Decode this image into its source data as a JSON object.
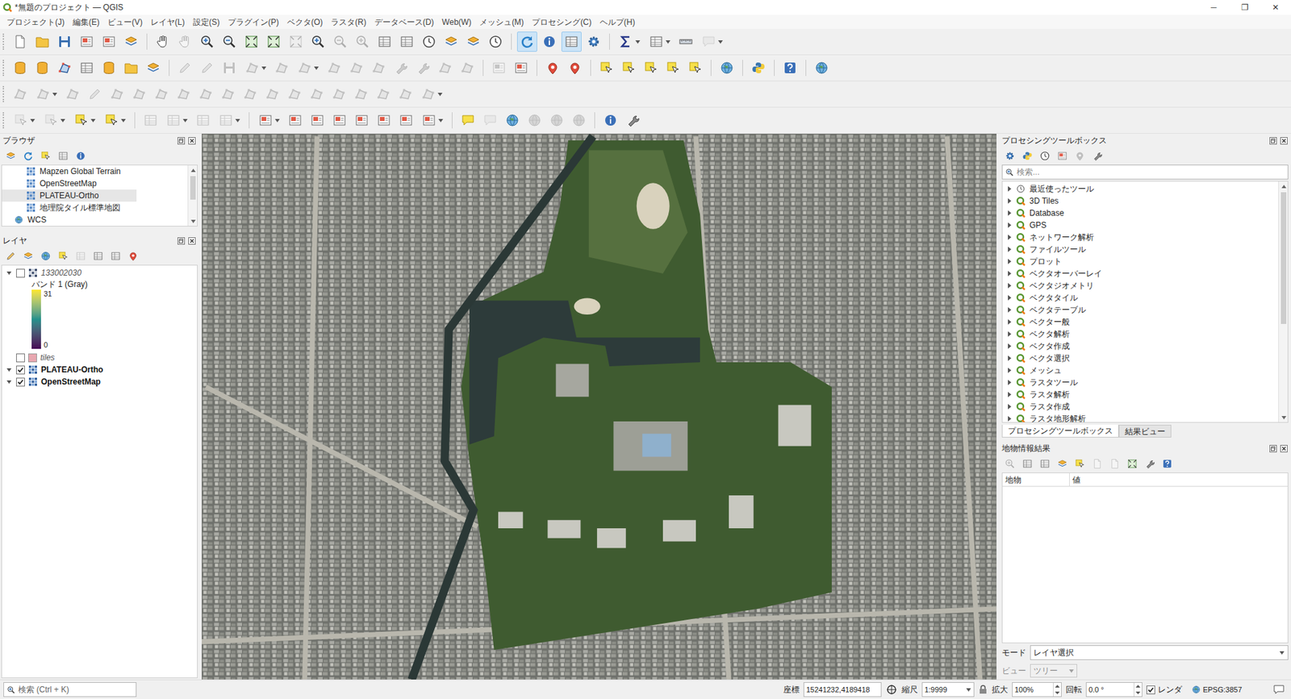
{
  "window": {
    "title": "*無題のプロジェクト — QGIS",
    "controls": [
      "─",
      "❐",
      "✕"
    ]
  },
  "menu": [
    "プロジェクト(J)",
    "編集(E)",
    "ビュー(V)",
    "レイヤ(L)",
    "設定(S)",
    "プラグイン(P)",
    "ベクタ(O)",
    "ラスタ(R)",
    "データベース(D)",
    "Web(W)",
    "メッシュ(M)",
    "プロセシング(C)",
    "ヘルプ(H)"
  ],
  "toolbars": [
    [
      {
        "kind": "icon",
        "disabled": false,
        "pressed": false
      },
      {
        "kind": "icon",
        "disabled": false,
        "pressed": false
      },
      {
        "kind": "icon",
        "disabled": false,
        "pressed": false
      },
      {
        "kind": "icon",
        "disabled": false,
        "pressed": false
      },
      {
        "kind": "icon",
        "disabled": false,
        "pressed": false
      },
      {
        "kind": "icon",
        "disabled": false,
        "pressed": false
      },
      {
        "kind": "sep"
      },
      {
        "kind": "icon",
        "disabled": false,
        "pressed": false
      },
      {
        "kind": "icon",
        "disabled": true,
        "pressed": false
      },
      {
        "kind": "icon",
        "disabled": false,
        "pressed": false
      },
      {
        "kind": "icon",
        "disabled": false,
        "pressed": false
      },
      {
        "kind": "icon",
        "disabled": false,
        "pressed": false
      },
      {
        "kind": "icon",
        "disabled": false,
        "pressed": false
      },
      {
        "kind": "icon",
        "disabled": true,
        "pressed": false
      },
      {
        "kind": "icon",
        "disabled": false,
        "pressed": false
      },
      {
        "kind": "icon",
        "disabled": true,
        "pressed": false
      },
      {
        "kind": "icon",
        "disabled": true,
        "pressed": false
      },
      {
        "kind": "icon",
        "disabled": false,
        "pressed": false
      },
      {
        "kind": "icon",
        "disabled": false,
        "pressed": false
      },
      {
        "kind": "icon",
        "disabled": false,
        "pressed": false
      },
      {
        "kind": "icon",
        "disabled": false,
        "pressed": false
      },
      {
        "kind": "icon",
        "disabled": false,
        "pressed": false
      },
      {
        "kind": "icon",
        "disabled": false,
        "pressed": false
      },
      {
        "kind": "sep"
      },
      {
        "kind": "icon",
        "disabled": false,
        "pressed": true
      },
      {
        "kind": "icon",
        "disabled": false,
        "pressed": false
      },
      {
        "kind": "icon",
        "disabled": false,
        "pressed": true
      },
      {
        "kind": "icon",
        "disabled": false,
        "pressed": false
      },
      {
        "kind": "sep"
      },
      {
        "kind": "drop",
        "disabled": false,
        "pressed": false
      },
      {
        "kind": "drop",
        "disabled": false,
        "pressed": false
      },
      {
        "kind": "icon",
        "disabled": false,
        "pressed": false
      },
      {
        "kind": "drop",
        "disabled": true,
        "pressed": false
      }
    ],
    [
      {
        "kind": "icon",
        "disabled": false,
        "pressed": false
      },
      {
        "kind": "icon",
        "disabled": false,
        "pressed": false
      },
      {
        "kind": "icon",
        "disabled": false,
        "pressed": false
      },
      {
        "kind": "icon",
        "disabled": false,
        "pressed": false
      },
      {
        "kind": "icon",
        "disabled": false,
        "pressed": false
      },
      {
        "kind": "icon",
        "disabled": false,
        "pressed": false
      },
      {
        "kind": "icon",
        "disabled": false,
        "pressed": false
      },
      {
        "kind": "sep"
      },
      {
        "kind": "icon",
        "disabled": true,
        "pressed": false
      },
      {
        "kind": "icon",
        "disabled": true,
        "pressed": false
      },
      {
        "kind": "icon",
        "disabled": true,
        "pressed": false
      },
      {
        "kind": "drop",
        "disabled": true,
        "pressed": false
      },
      {
        "kind": "icon",
        "disabled": true,
        "pressed": false
      },
      {
        "kind": "drop",
        "disabled": true,
        "pressed": false
      },
      {
        "kind": "icon",
        "disabled": true,
        "pressed": false
      },
      {
        "kind": "icon",
        "disabled": true,
        "pressed": false
      },
      {
        "kind": "icon",
        "disabled": true,
        "pressed": false
      },
      {
        "kind": "icon",
        "disabled": true,
        "pressed": false
      },
      {
        "kind": "icon",
        "disabled": true,
        "pressed": false
      },
      {
        "kind": "icon",
        "disabled": true,
        "pressed": false
      },
      {
        "kind": "icon",
        "disabled": true,
        "pressed": false
      },
      {
        "kind": "sep"
      },
      {
        "kind": "icon",
        "disabled": true,
        "pressed": false
      },
      {
        "kind": "icon",
        "disabled": false,
        "pressed": false
      },
      {
        "kind": "sep"
      },
      {
        "kind": "icon",
        "disabled": false,
        "pressed": false
      },
      {
        "kind": "icon",
        "disabled": false,
        "pressed": false
      },
      {
        "kind": "sep"
      },
      {
        "kind": "icon",
        "disabled": false,
        "pressed": false
      },
      {
        "kind": "icon",
        "disabled": false,
        "pressed": false
      },
      {
        "kind": "icon",
        "disabled": false,
        "pressed": false
      },
      {
        "kind": "icon",
        "disabled": false,
        "pressed": false
      },
      {
        "kind": "icon",
        "disabled": false,
        "pressed": false
      },
      {
        "kind": "sep"
      },
      {
        "kind": "icon",
        "disabled": false,
        "pressed": false
      },
      {
        "kind": "sep"
      },
      {
        "kind": "icon",
        "disabled": false,
        "pressed": false
      },
      {
        "kind": "sep"
      },
      {
        "kind": "icon",
        "disabled": false,
        "pressed": false
      },
      {
        "kind": "sep"
      },
      {
        "kind": "icon",
        "disabled": false,
        "pressed": false
      }
    ],
    [
      {
        "kind": "icon",
        "disabled": true,
        "pressed": false
      },
      {
        "kind": "drop",
        "disabled": true,
        "pressed": false
      },
      {
        "kind": "icon",
        "disabled": true,
        "pressed": false
      },
      {
        "kind": "icon",
        "disabled": true,
        "pressed": false
      },
      {
        "kind": "icon",
        "disabled": true,
        "pressed": false
      },
      {
        "kind": "icon",
        "disabled": true,
        "pressed": false
      },
      {
        "kind": "icon",
        "disabled": true,
        "pressed": false
      },
      {
        "kind": "icon",
        "disabled": true,
        "pressed": false
      },
      {
        "kind": "icon",
        "disabled": true,
        "pressed": false
      },
      {
        "kind": "icon",
        "disabled": true,
        "pressed": false
      },
      {
        "kind": "icon",
        "disabled": true,
        "pressed": false
      },
      {
        "kind": "icon",
        "disabled": true,
        "pressed": false
      },
      {
        "kind": "icon",
        "disabled": true,
        "pressed": false
      },
      {
        "kind": "icon",
        "disabled": true,
        "pressed": false
      },
      {
        "kind": "icon",
        "disabled": true,
        "pressed": false
      },
      {
        "kind": "icon",
        "disabled": true,
        "pressed": false
      },
      {
        "kind": "icon",
        "disabled": true,
        "pressed": false
      },
      {
        "kind": "icon",
        "disabled": true,
        "pressed": false
      },
      {
        "kind": "drop",
        "disabled": true,
        "pressed": false
      }
    ],
    [
      {
        "kind": "drop",
        "disabled": true,
        "pressed": false
      },
      {
        "kind": "drop",
        "disabled": true,
        "pressed": false
      },
      {
        "kind": "drop",
        "disabled": false,
        "pressed": false
      },
      {
        "kind": "drop",
        "disabled": false,
        "pressed": false
      },
      {
        "kind": "sep"
      },
      {
        "kind": "icon",
        "disabled": true,
        "pressed": false
      },
      {
        "kind": "drop",
        "disabled": true,
        "pressed": false
      },
      {
        "kind": "icon",
        "disabled": true,
        "pressed": false
      },
      {
        "kind": "drop",
        "disabled": true,
        "pressed": false
      },
      {
        "kind": "sep"
      },
      {
        "kind": "drop",
        "disabled": false,
        "pressed": false
      },
      {
        "kind": "icon",
        "disabled": false,
        "pressed": false
      },
      {
        "kind": "icon",
        "disabled": false,
        "pressed": false
      },
      {
        "kind": "icon",
        "disabled": false,
        "pressed": false
      },
      {
        "kind": "icon",
        "disabled": false,
        "pressed": false
      },
      {
        "kind": "icon",
        "disabled": false,
        "pressed": false
      },
      {
        "kind": "icon",
        "disabled": false,
        "pressed": false
      },
      {
        "kind": "drop",
        "disabled": false,
        "pressed": false
      },
      {
        "kind": "sep"
      },
      {
        "kind": "icon",
        "disabled": false,
        "pressed": false
      },
      {
        "kind": "icon",
        "disabled": true,
        "pressed": false
      },
      {
        "kind": "icon",
        "disabled": false,
        "pressed": false
      },
      {
        "kind": "icon",
        "disabled": true,
        "pressed": false
      },
      {
        "kind": "icon",
        "disabled": true,
        "pressed": false
      },
      {
        "kind": "icon",
        "disabled": true,
        "pressed": false
      },
      {
        "kind": "sep"
      },
      {
        "kind": "icon",
        "disabled": false,
        "pressed": false
      },
      {
        "kind": "icon",
        "disabled": false,
        "pressed": false
      }
    ]
  ],
  "browser": {
    "title": "ブラウザ",
    "tools": [
      {
        "disabled": false
      },
      {
        "disabled": false
      },
      {
        "disabled": false
      },
      {
        "disabled": false
      },
      {
        "disabled": false
      }
    ],
    "items": [
      {
        "label": "Mapzen Global Terrain",
        "kind": "xyz",
        "selected": false
      },
      {
        "label": "OpenStreetMap",
        "kind": "xyz",
        "selected": false
      },
      {
        "label": "PLATEAU-Ortho",
        "kind": "xyz",
        "selected": true
      },
      {
        "label": "地理院タイル標準地図",
        "kind": "xyz",
        "selected": false
      },
      {
        "label": "WCS",
        "kind": "wcs",
        "selected": false
      }
    ]
  },
  "layers": {
    "title": "レイヤ",
    "tools": [
      {
        "disabled": false
      },
      {
        "disabled": false
      },
      {
        "disabled": false
      },
      {
        "disabled": false
      },
      {
        "disabled": true
      },
      {
        "disabled": false
      },
      {
        "disabled": false
      },
      {
        "disabled": false
      }
    ],
    "items": [
      {
        "name": "133002030",
        "kind": "raster",
        "checked": false,
        "expanded": true,
        "legend": {
          "band": "バンド 1 (Gray)",
          "max": "31",
          "min": "0"
        }
      },
      {
        "name": "tiles",
        "kind": "vector",
        "checked": false,
        "color": "#e8a7b0"
      },
      {
        "name": "PLATEAU-Ortho",
        "kind": "tile",
        "checked": true,
        "expanded": true
      },
      {
        "name": "OpenStreetMap",
        "kind": "tile",
        "checked": true,
        "expanded": true
      }
    ]
  },
  "processing": {
    "title": "プロセシングツールボックス",
    "tools": [
      {
        "disabled": false
      },
      {
        "disabled": false
      },
      {
        "disabled": false
      },
      {
        "disabled": false
      },
      {
        "disabled": true
      },
      {
        "disabled": false
      }
    ],
    "search": {
      "placeholder": "検索..."
    },
    "items": [
      {
        "label": "最近使ったツール",
        "kind": "recent",
        "expanded": false
      },
      {
        "label": "3D Tiles",
        "kind": "provider",
        "expanded": false
      },
      {
        "label": "Database",
        "kind": "provider",
        "expanded": false
      },
      {
        "label": "GPS",
        "kind": "provider",
        "expanded": false
      },
      {
        "label": "ネットワーク解析",
        "kind": "provider",
        "expanded": false
      },
      {
        "label": "ファイルツール",
        "kind": "provider",
        "expanded": false
      },
      {
        "label": "プロット",
        "kind": "provider",
        "expanded": false
      },
      {
        "label": "ベクタオーバーレイ",
        "kind": "provider",
        "expanded": false
      },
      {
        "label": "ベクタジオメトリ",
        "kind": "provider",
        "expanded": false
      },
      {
        "label": "ベクタタイル",
        "kind": "provider",
        "expanded": false
      },
      {
        "label": "ベクタテーブル",
        "kind": "provider",
        "expanded": false
      },
      {
        "label": "ベクター般",
        "kind": "provider",
        "expanded": false
      },
      {
        "label": "ベクタ解析",
        "kind": "provider",
        "expanded": false
      },
      {
        "label": "ベクタ作成",
        "kind": "provider",
        "expanded": false
      },
      {
        "label": "ベクタ選択",
        "kind": "provider",
        "expanded": false
      },
      {
        "label": "メッシュ",
        "kind": "provider",
        "expanded": false
      },
      {
        "label": "ラスタツール",
        "kind": "provider",
        "expanded": false
      },
      {
        "label": "ラスタ解析",
        "kind": "provider",
        "expanded": false
      },
      {
        "label": "ラスタ作成",
        "kind": "provider",
        "expanded": false
      },
      {
        "label": "ラスタ地形解析",
        "kind": "provider",
        "expanded": false
      }
    ],
    "tabs": [
      {
        "label": "プロセシングツールボックス",
        "selected": true
      },
      {
        "label": "結果ビュー",
        "selected": false
      }
    ]
  },
  "identify": {
    "title": "地物情報結果",
    "tools": [
      {
        "disabled": true
      },
      {
        "disabled": false
      },
      {
        "disabled": false
      },
      {
        "disabled": false
      },
      {
        "disabled": false
      },
      {
        "disabled": true
      },
      {
        "disabled": true
      },
      {
        "disabled": false
      },
      {
        "disabled": false
      },
      {
        "disabled": false
      }
    ],
    "columns": [
      "地物",
      "値"
    ],
    "mode": {
      "label": "モード",
      "value": "レイヤ選択"
    },
    "view": {
      "label": "ビュー",
      "value": "ツリー",
      "disabled": true
    }
  },
  "status_bar": {
    "search": {
      "placeholder": "検索 (Ctrl + K)"
    },
    "coord_label": "座標",
    "coord": "15241232,4189418",
    "scale_label": "縮尺",
    "scale": "1:9999",
    "magnifier_label": "拡大",
    "magnifier": "100%",
    "rotation_label": "回転",
    "rotation": "0.0 °",
    "render": {
      "label": "レンダ",
      "checked": true
    },
    "crs": "EPSG:3857"
  }
}
